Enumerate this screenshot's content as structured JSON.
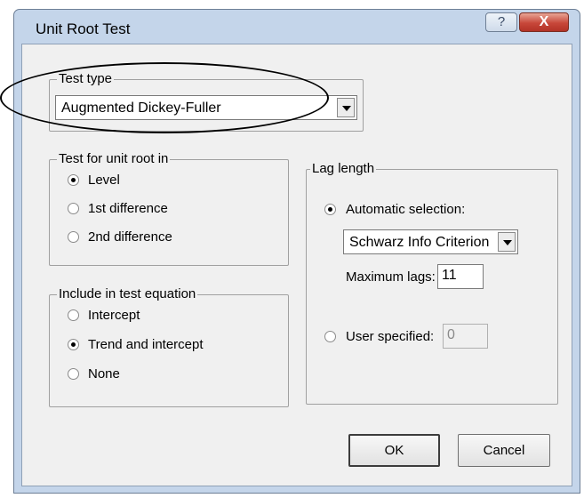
{
  "window": {
    "title": "Unit Root Test",
    "help_glyph": "?",
    "close_glyph": "X"
  },
  "test_type": {
    "legend": "Test type",
    "selected": "Augmented Dickey-Fuller"
  },
  "unit_root_in": {
    "legend": "Test for unit root in",
    "options": [
      {
        "label": "Level",
        "checked": true
      },
      {
        "label": "1st difference",
        "checked": false
      },
      {
        "label": "2nd difference",
        "checked": false
      }
    ]
  },
  "test_equation": {
    "legend": "Include in test equation",
    "options": [
      {
        "label": "Intercept",
        "checked": false
      },
      {
        "label": "Trend and intercept",
        "checked": true
      },
      {
        "label": "None",
        "checked": false
      }
    ]
  },
  "lag_length": {
    "legend": "Lag length",
    "automatic_label": "Automatic selection:",
    "automatic_checked": true,
    "criterion_selected": "Schwarz Info Criterion",
    "max_lags_label": "Maximum lags:",
    "max_lags_value": "11",
    "user_label": "User specified:",
    "user_checked": false,
    "user_value": "0"
  },
  "buttons": {
    "ok": "OK",
    "cancel": "Cancel"
  },
  "icons": [
    "help-icon",
    "close-icon",
    "chevron-down-icon"
  ],
  "colors": {
    "titlebar": "#c4d5ea",
    "client": "#f0f0f0",
    "close": "#c7473a"
  }
}
